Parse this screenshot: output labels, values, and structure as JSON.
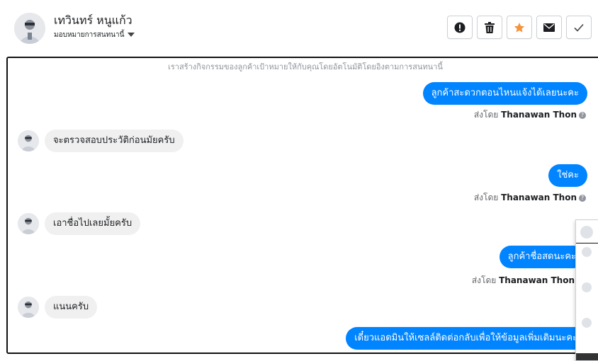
{
  "header": {
    "name": "เทวินทร์ หนูแก้ว",
    "assign_label": "มอบหมายการสนทนานี้",
    "actions": [
      {
        "name": "report-icon"
      },
      {
        "name": "trash-icon"
      },
      {
        "name": "star-icon"
      },
      {
        "name": "mail-icon"
      },
      {
        "name": "check-icon"
      }
    ]
  },
  "notice": "เราสร้างกิจกรรมของลูกค้าเป้าหมายให้กับคุณโดยอัตโนมัติโดยอิงตามการสนทนานี้",
  "sent_by_prefix": "ส่งโดย",
  "agent_name": "Thanawan Thon",
  "messages": {
    "m1": "ลูกค้าสะดวกตอนไหนแจ้งได้เลยนะคะ",
    "m2": "จะตรวจสอบประวัติก่อนมัยครับ",
    "m3": "ใช่คะ",
    "m4": "เอาชื่อไปเลยมั้ยครับ",
    "m5": "ลูกค้าชื่อสดนะคะ",
    "m6": "แนนครับ",
    "m7": "เดี๋ยวแอดมินให้เซลล์ติดต่อกลับเพื่อให้ข้อมูลเพิ่มเติมนะคะ"
  },
  "colors": {
    "accent": "#0084ff",
    "star": "#f5933a",
    "incoming": "#f0f0f0"
  }
}
